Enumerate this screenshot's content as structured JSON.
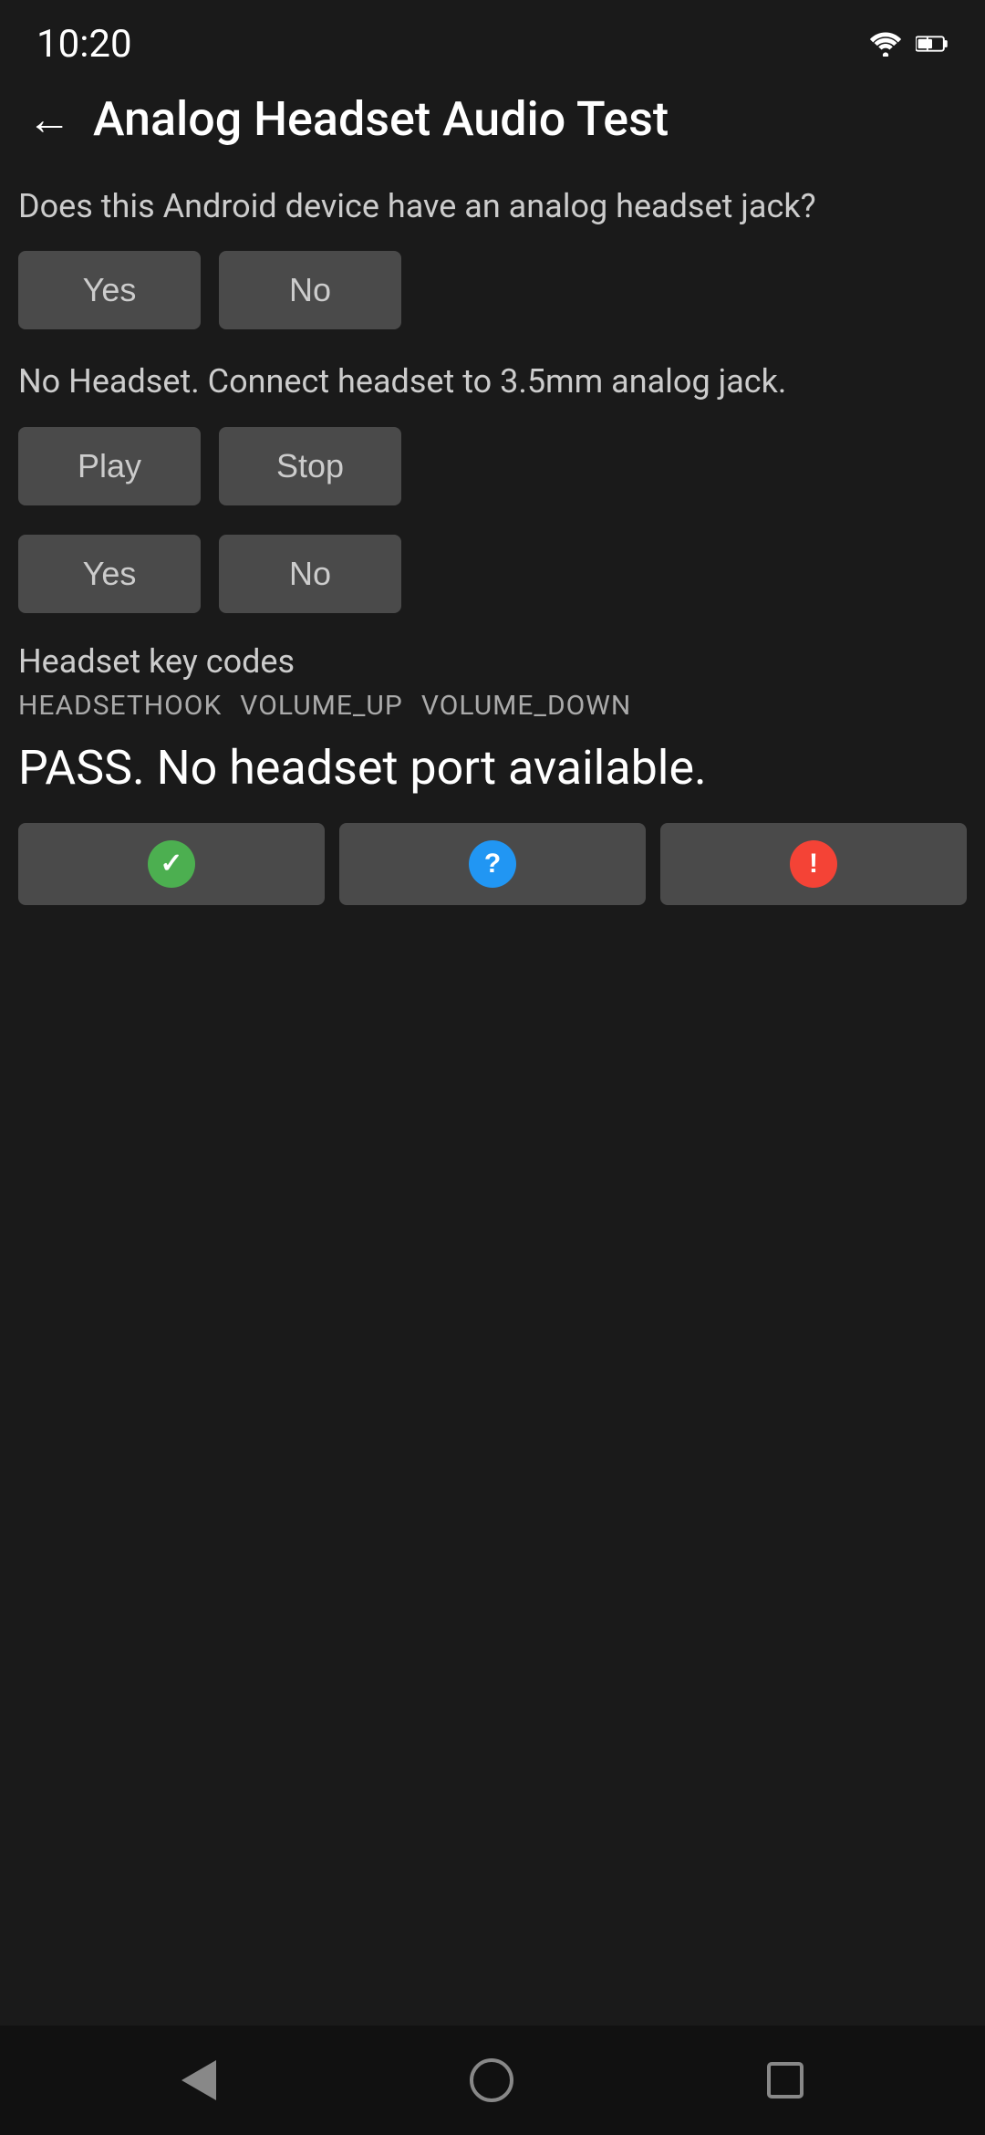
{
  "status_bar": {
    "time": "10:20"
  },
  "app_bar": {
    "back_label": "←",
    "title": "Analog Headset Audio Test"
  },
  "jack_question": {
    "text": "Does this Android device have an analog headset jack?",
    "yes_label": "Yes",
    "no_label": "No"
  },
  "headset_status": {
    "text": "No Headset. Connect headset to 3.5mm analog jack."
  },
  "playback_controls": {
    "play_label": "Play",
    "stop_label": "Stop"
  },
  "result_question": {
    "yes_label": "Yes",
    "no_label": "No"
  },
  "headset_keys": {
    "label": "Headset key codes",
    "codes": [
      "HEADSETHOOK",
      "VOLUME_UP",
      "VOLUME_DOWN"
    ]
  },
  "pass_message": "PASS. No headset port available.",
  "result_buttons": {
    "pass_icon": "✓",
    "info_icon": "?",
    "fail_icon": "!"
  }
}
